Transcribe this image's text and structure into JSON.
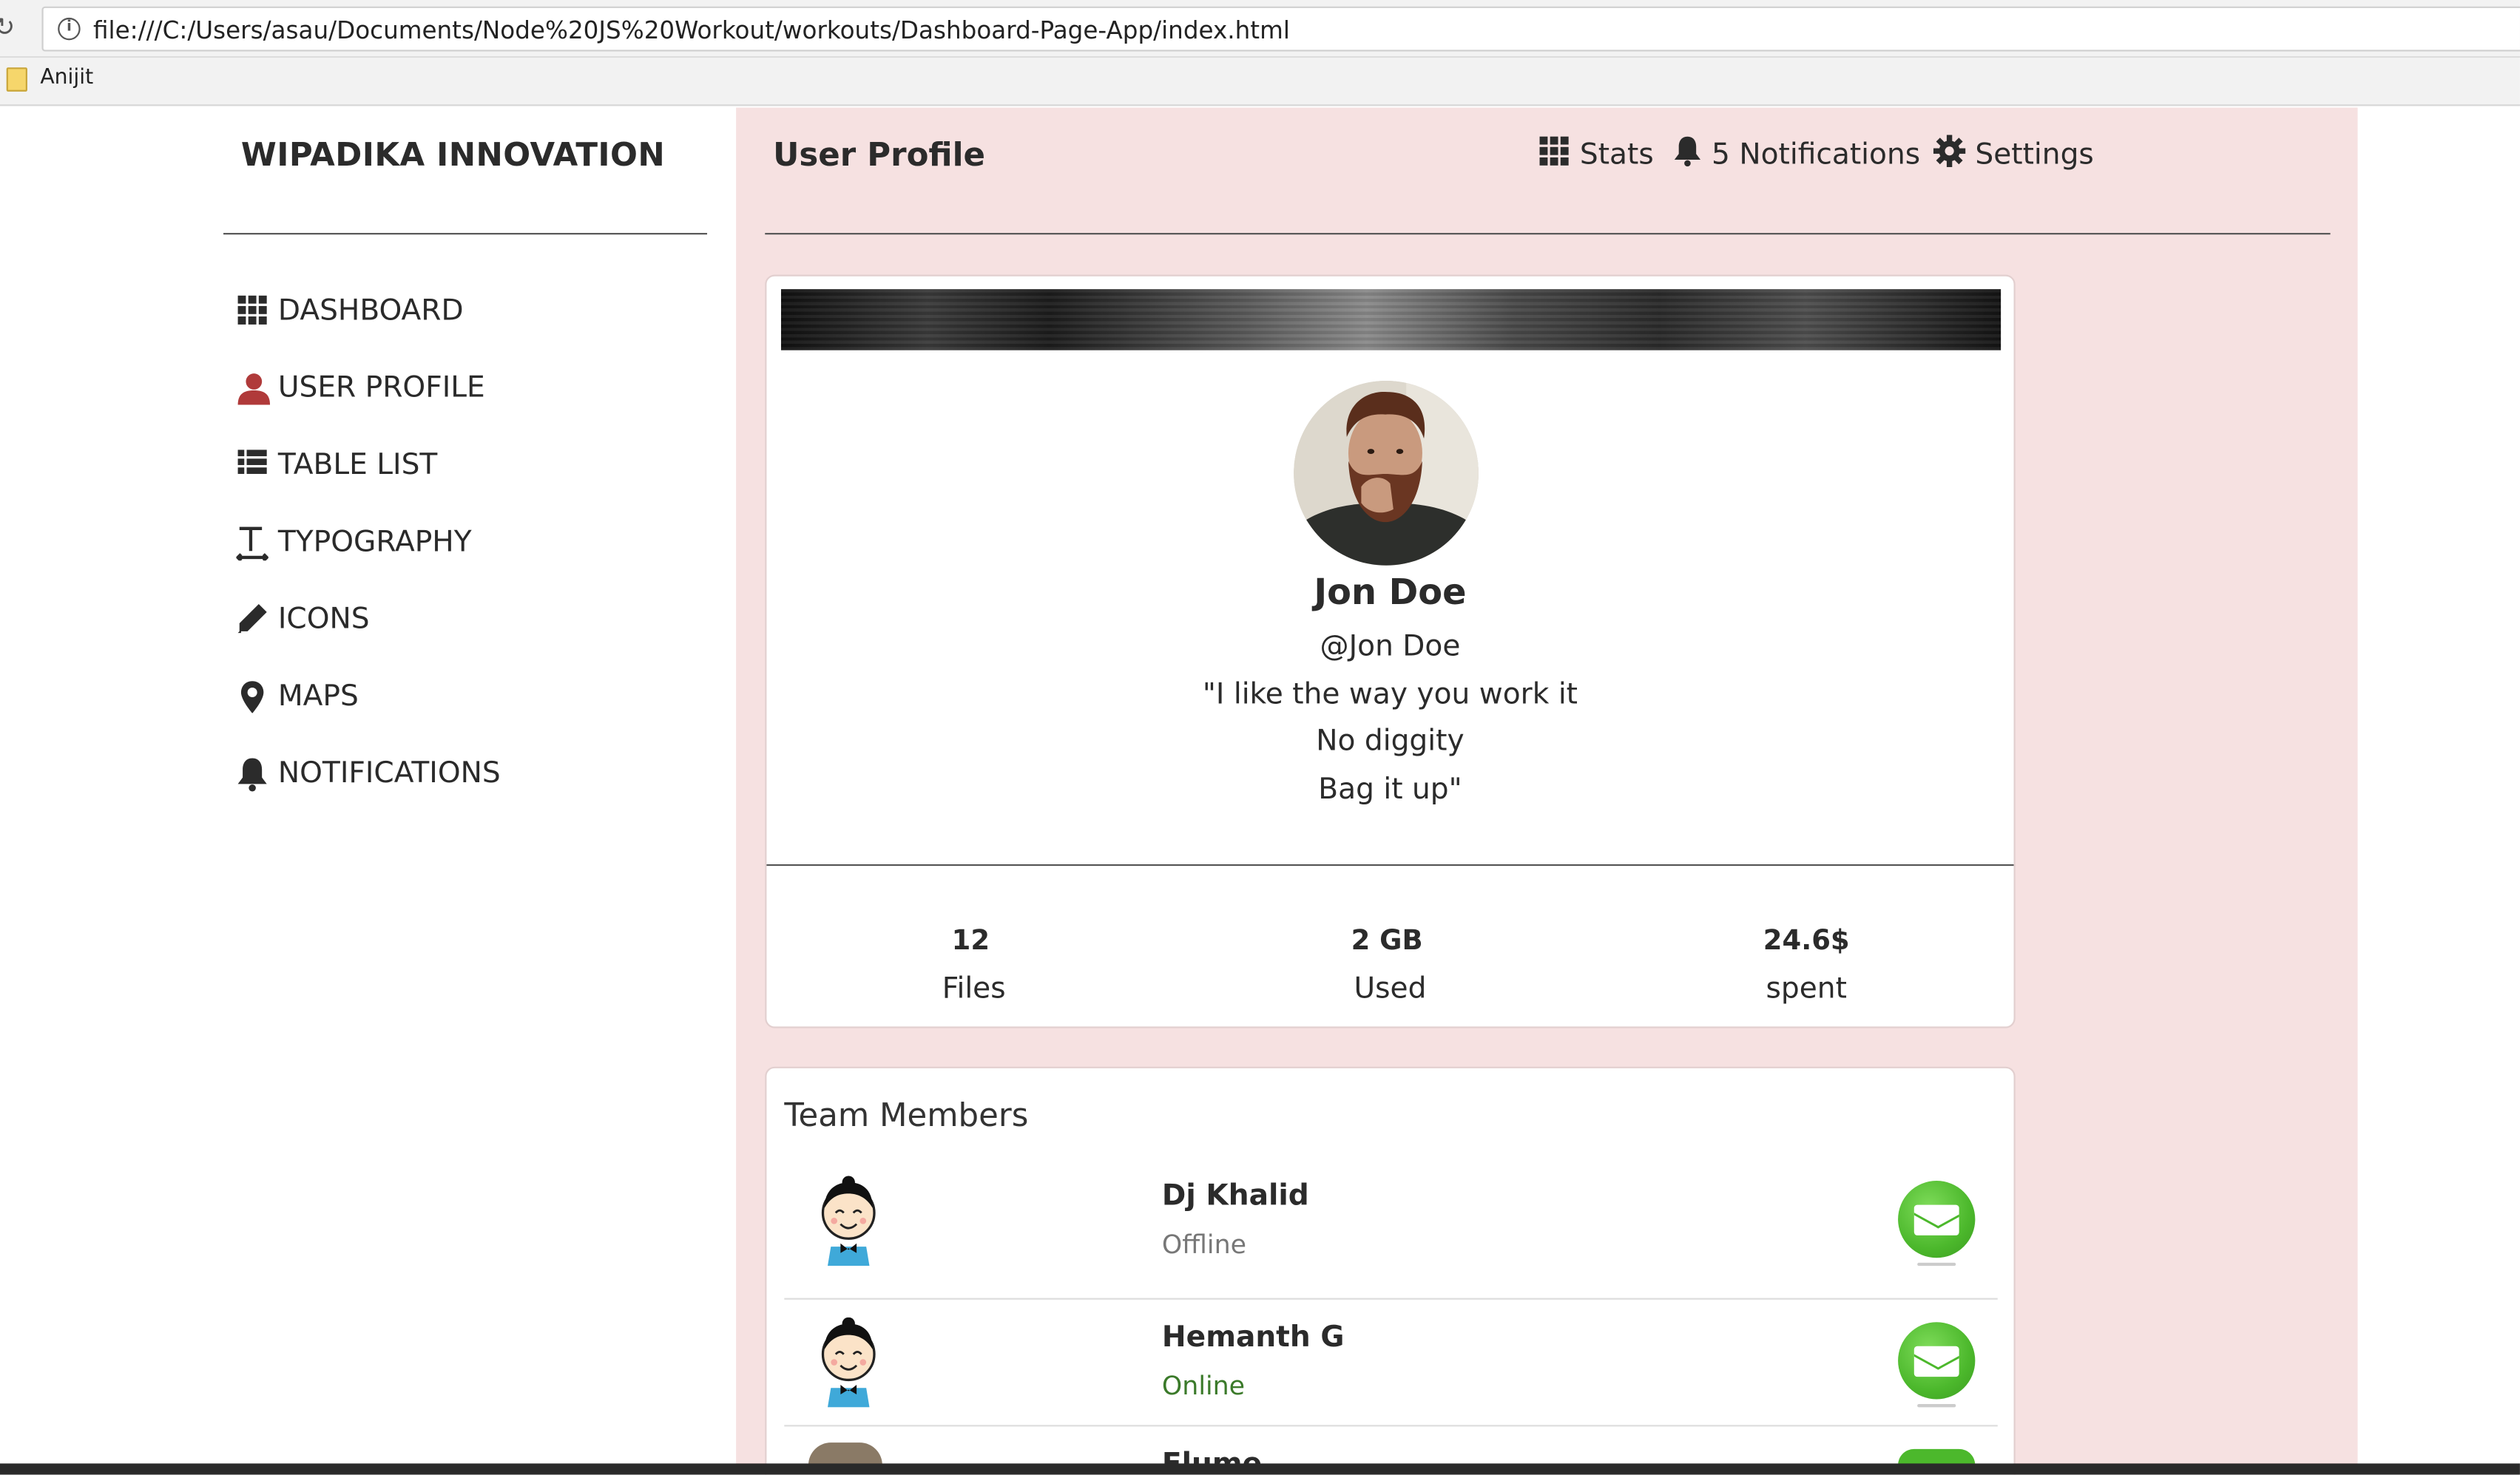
{
  "browser": {
    "url": "file:///C:/Users/asau/Documents/Node%20JS%20Workout/workouts/Dashboard-Page-App/index.html",
    "bookmark": "Anijit"
  },
  "sidebar": {
    "brand": "WIPADIKA INNOVATION",
    "items": [
      {
        "label": "DASHBOARD",
        "icon": "grid-icon"
      },
      {
        "label": "USER PROFILE",
        "icon": "user-icon",
        "color": "#b03a3a"
      },
      {
        "label": "TABLE LIST",
        "icon": "list-icon"
      },
      {
        "label": "TYPOGRAPHY",
        "icon": "text-icon"
      },
      {
        "label": "ICONS",
        "icon": "pencil-icon"
      },
      {
        "label": "MAPS",
        "icon": "map-pin-icon"
      },
      {
        "label": "NOTIFICATIONS",
        "icon": "bell-icon"
      }
    ]
  },
  "header": {
    "title": "User Profile",
    "stats_label": "Stats",
    "notifications_label": "5 Notifications",
    "settings_label": "Settings"
  },
  "profile": {
    "name": "Jon Doe",
    "handle": "@Jon Doe",
    "quote": [
      "\"I like the way you work it",
      "No diggity",
      "Bag it up\""
    ],
    "stats": [
      {
        "value": "12",
        "label": "Files"
      },
      {
        "value": "2 GB",
        "label": "Used"
      },
      {
        "value": "24.6$",
        "label": "spent"
      }
    ]
  },
  "team": {
    "title": "Team Members",
    "members": [
      {
        "name": "Dj Khalid",
        "status": "Offline",
        "status_color": "#777777"
      },
      {
        "name": "Hemanth G",
        "status": "Online",
        "status_color": "#3b7a2a"
      },
      {
        "name": "Flume"
      }
    ]
  },
  "colors": {
    "main_background": "#f6e1e1",
    "mail_button": "#4cb82c"
  }
}
